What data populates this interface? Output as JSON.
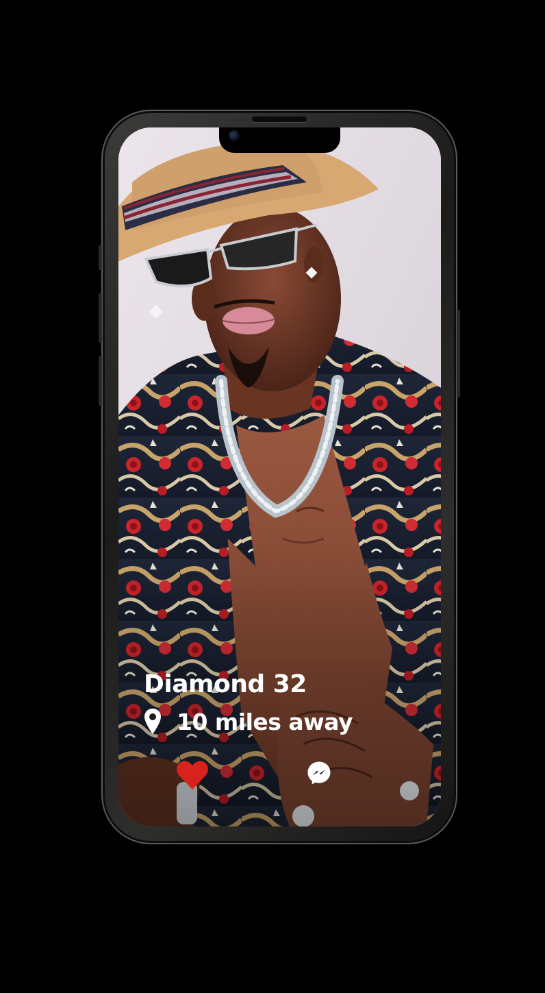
{
  "profile": {
    "name_age": "Diamond 32",
    "distance": "10 miles away"
  },
  "actions": {
    "like_icon": "heart-icon",
    "message_icon": "messenger-icon"
  },
  "colors": {
    "background": "#000000",
    "like": "#d8231d",
    "text": "#ffffff"
  }
}
